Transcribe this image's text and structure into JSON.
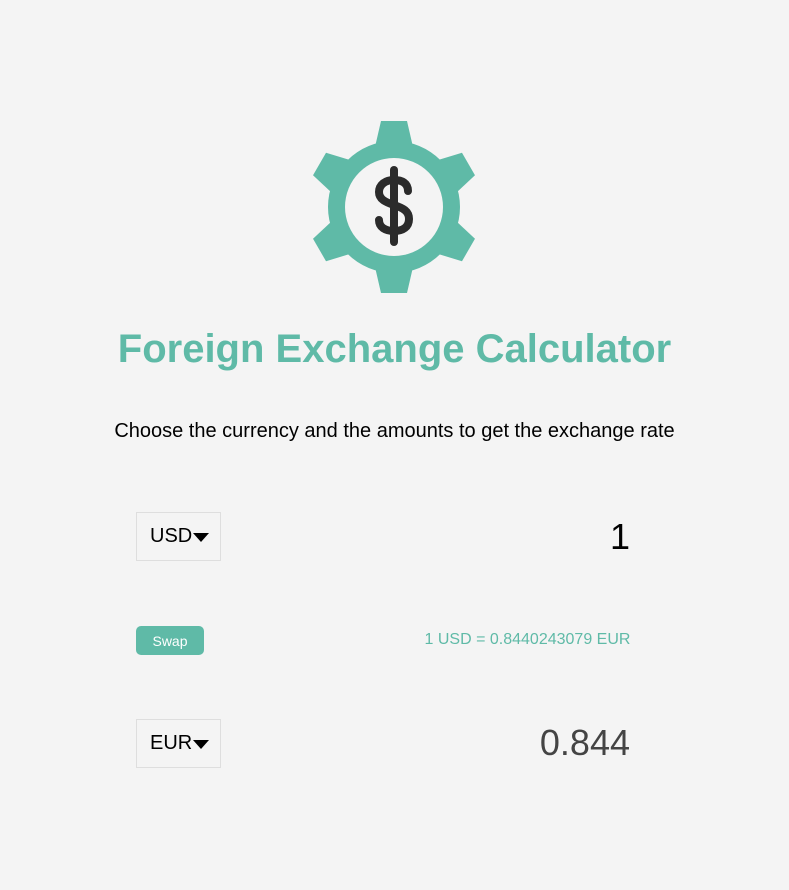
{
  "header": {
    "logo_icon": "dollar-gear-icon",
    "title": "Foreign Exchange Calculator",
    "subtitle": "Choose the currency and the amounts to get the exchange rate"
  },
  "converter": {
    "from_currency": "USD",
    "from_amount": "1",
    "swap_label": "Swap",
    "rate_text": "1 USD = 0.8440243079 EUR",
    "to_currency": "EUR",
    "to_amount": "0.844"
  },
  "colors": {
    "accent": "#5fbaa7",
    "background": "#f4f4f4",
    "icon_dark": "#2b2b2b"
  }
}
